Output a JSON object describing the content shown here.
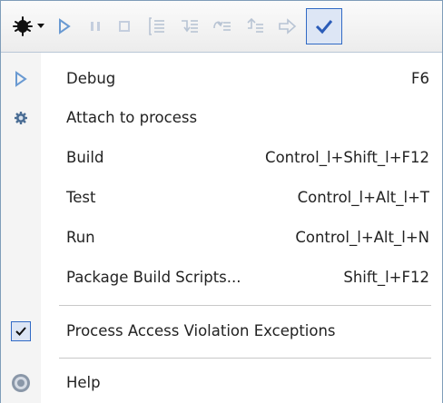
{
  "toolbar": {
    "buttons": [
      {
        "icon": "bug-icon",
        "enabled": true
      },
      {
        "icon": "dropdown-arrow-icon",
        "enabled": true
      },
      {
        "icon": "play-icon",
        "enabled": false
      },
      {
        "icon": "pause-icon",
        "enabled": false
      },
      {
        "icon": "stop-icon",
        "enabled": false
      },
      {
        "icon": "step-into-icon",
        "enabled": false
      },
      {
        "icon": "step-over-icon",
        "enabled": false
      },
      {
        "icon": "step-out-icon",
        "enabled": false
      },
      {
        "icon": "step-back-icon",
        "enabled": false
      },
      {
        "icon": "go-to-icon",
        "enabled": false
      },
      {
        "icon": "checkmark-icon",
        "enabled": true,
        "checked": true
      }
    ]
  },
  "menu": {
    "items": [
      {
        "label": "Debug",
        "shortcut": "F6",
        "icon": "play-icon"
      },
      {
        "label": "Attach to process",
        "shortcut": "",
        "icon": "gear-icon"
      },
      {
        "label": "Build",
        "shortcut": "Control_l+Shift_l+F12",
        "icon": ""
      },
      {
        "label": "Test",
        "shortcut": "Control_l+Alt_l+T",
        "icon": ""
      },
      {
        "label": "Run",
        "shortcut": "Control_l+Alt_l+N",
        "icon": ""
      },
      {
        "label": "Package Build Scripts...",
        "shortcut": "Shift_l+F12",
        "icon": ""
      },
      {
        "label": "Process Access Violation Exceptions",
        "shortcut": "",
        "icon": "checkmark-icon",
        "checked": true
      },
      {
        "label": "Help",
        "shortcut": "",
        "icon": "help-icon"
      }
    ]
  },
  "colors": {
    "accent": "#316ac5",
    "play_blue": "#6a9ad2",
    "disabled": "#b8c4d4"
  }
}
